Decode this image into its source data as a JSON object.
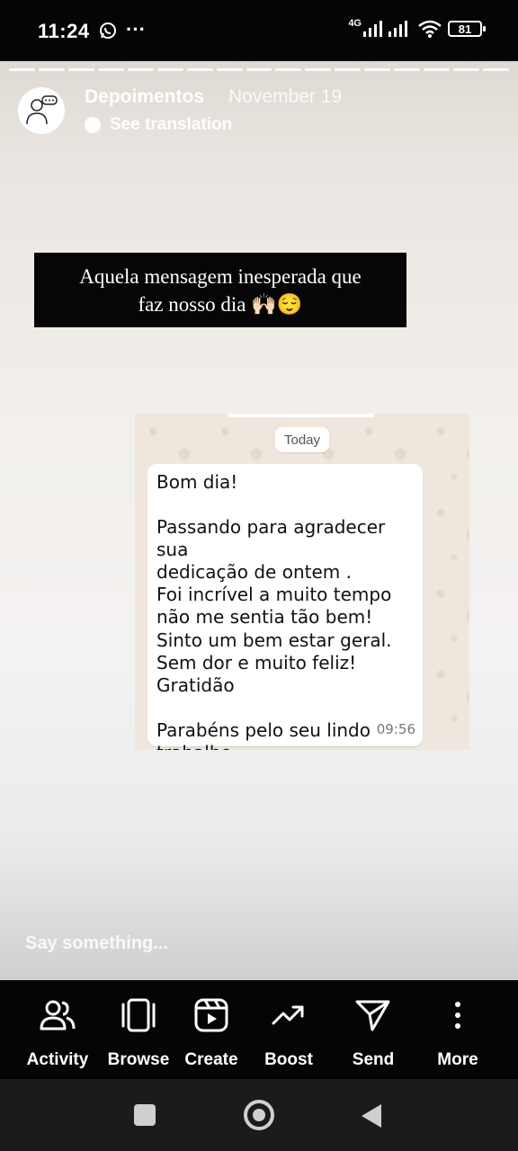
{
  "status_bar": {
    "time": "11:24",
    "network": "4G",
    "battery": "81"
  },
  "story": {
    "account_name": "Depoimentos",
    "date": "November 19",
    "see_translation": "See translation",
    "quote_line1": "Aquela mensagem inesperada que",
    "quote_line2": "faz nosso dia 🙌🏻😌",
    "reply_placeholder": "Say something..."
  },
  "chat": {
    "date_badge": "Today",
    "message_lines": [
      "Bom dia!",
      "",
      "Passando para agradecer sua",
      "dedicação de ontem .",
      "Foi incrível a muito tempo",
      "não me sentia tão bem!",
      "Sinto um bem estar geral.",
      "Sem dor e muito feliz!",
      "Gratidão",
      "",
      "Parabéns pelo seu lindo",
      "trabalho."
    ],
    "time": "09:56"
  },
  "actions": [
    {
      "label": "Activity",
      "icon": "people-icon"
    },
    {
      "label": "Browse",
      "icon": "browse-icon"
    },
    {
      "label": "Create",
      "icon": "reels-create-icon"
    },
    {
      "label": "Boost",
      "icon": "trending-icon"
    },
    {
      "label": "Send",
      "icon": "send-icon"
    },
    {
      "label": "More",
      "icon": "more-vertical-icon"
    }
  ]
}
